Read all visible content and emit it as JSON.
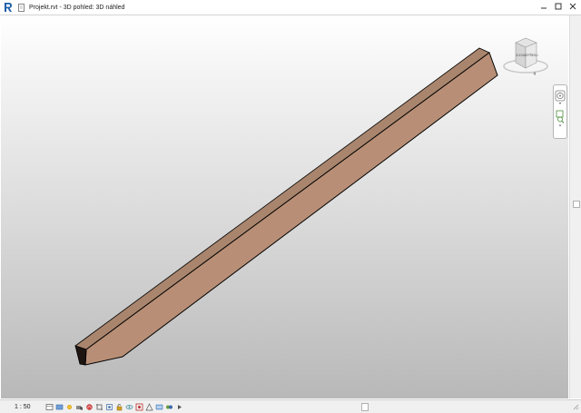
{
  "window": {
    "title": "Projekt.rvt - 3D pohled: 3D náhled",
    "app_icon": "revit-logo-icon",
    "controls": [
      "minimize-icon",
      "maximize-icon",
      "close-icon"
    ]
  },
  "viewcube": {
    "face_left": "ZLEVA",
    "face_right": "ZEPŘEDU"
  },
  "navigation_bar": {
    "items": [
      "steering-wheel-icon",
      "zoom-region-icon"
    ]
  },
  "view_control_bar": {
    "scale": "1 : 50",
    "icons": [
      "detail-level-icon",
      "visual-style-icon",
      "sun-path-icon",
      "shadows-icon",
      "render-icon",
      "crop-view-icon",
      "show-crop-icon",
      "unlock-3d-icon",
      "temporary-hide-icon",
      "reveal-hidden-icon",
      "analytical-model-icon",
      "highlight-displacement-icon",
      "worksharing-icon",
      "expand-arrow-icon"
    ]
  },
  "colors": {
    "beam_top": "#a9856d",
    "beam_front": "#b88f76",
    "beam_end": "#1e1410",
    "outline": "#000000",
    "app_icon": "#1d5fa8"
  }
}
